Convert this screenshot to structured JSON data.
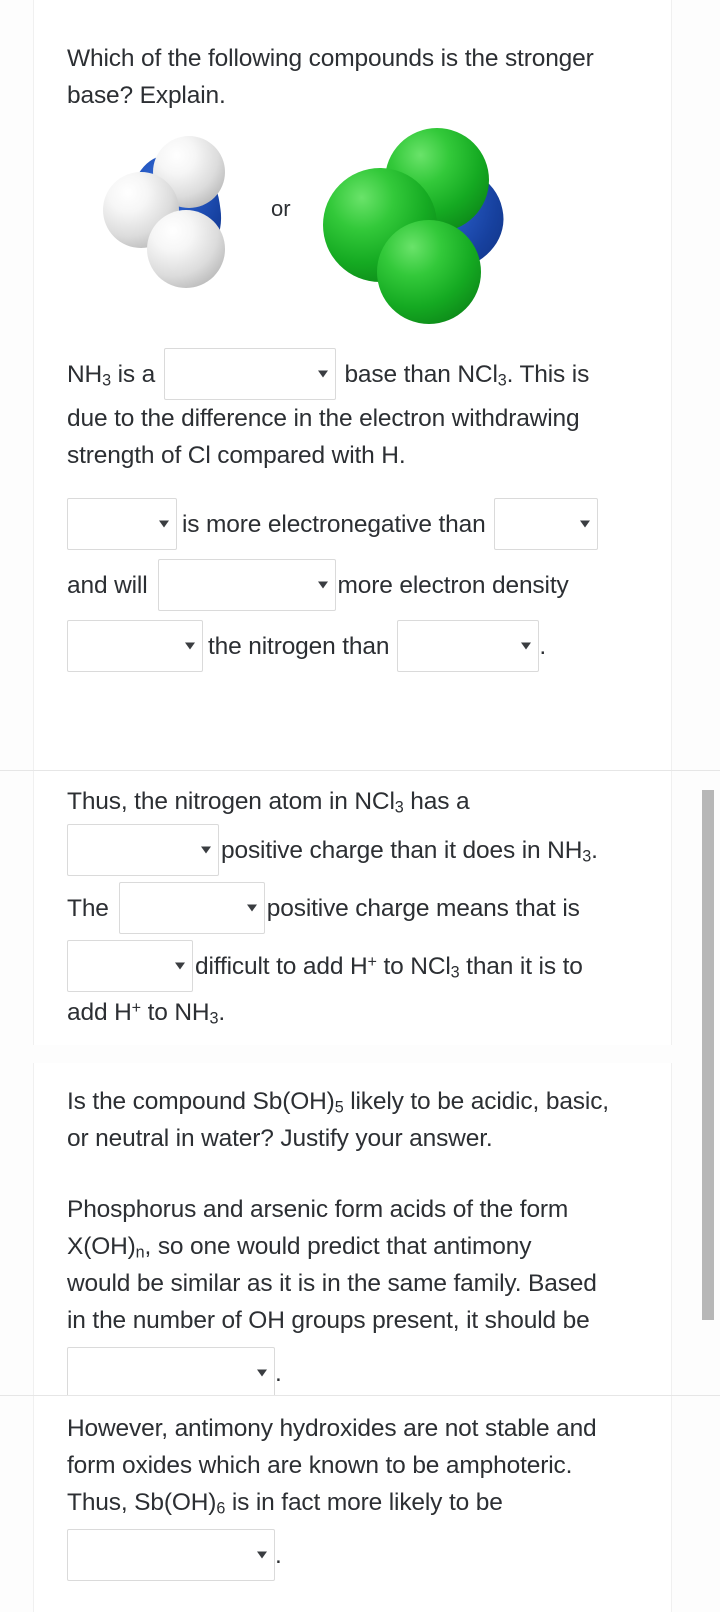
{
  "meta": {
    "accent_blue": "#1f4fb5",
    "chlorine_green": "#18a92a",
    "hydrogen_white": "#e8e8e8",
    "text_color": "#2c2f33",
    "border_color": "#dadada"
  },
  "card1": {
    "question": {
      "line1": "Which of the following compounds is the stronger",
      "line2": "base? Explain."
    },
    "molecules": {
      "left": {
        "name": "ammonia-model",
        "formula": "NH3",
        "center_atom": "N",
        "outer_atoms": [
          "H",
          "H",
          "H"
        ]
      },
      "separator": "or",
      "right": {
        "name": "nitrogen-trichloride-model",
        "formula": "NCl3",
        "center_atom": "N",
        "outer_atoms": [
          "Cl",
          "Cl",
          "Cl"
        ]
      }
    },
    "statement1": {
      "pre": "NH",
      "sub1": "3",
      "mid": " is a ",
      "dropdown1_value": "",
      "post": " base than NCl",
      "sub2": "3",
      "tail": ". This is"
    },
    "statement1_line2": "due to the difference in the electron withdrawing",
    "statement1_line3": "strength of Cl compared with H.",
    "statement2": {
      "dropdown2_value": "",
      "text1": "is more electronegative than",
      "dropdown3_value": ""
    },
    "statement3": {
      "text1": "and will",
      "dropdown4_value": "",
      "text2": "more electron density"
    },
    "statement4": {
      "dropdown5_value": "",
      "text1": "the nitrogen than",
      "dropdown6_value": "",
      "text2": "."
    }
  },
  "card2": {
    "line1": {
      "pre": "Thus, the nitrogen atom in NCl",
      "sub": "3",
      "post": " has a"
    },
    "line2": {
      "dropdown1_value": "",
      "text": "positive charge than it does in NH",
      "sub": "3",
      "post": "."
    },
    "line3": {
      "pre": "The",
      "dropdown2_value": "",
      "text": "positive charge means that is"
    },
    "line4": {
      "dropdown3_value": "",
      "pre": "difficult to add H",
      "sup1": "+",
      "mid": " to NCl",
      "sub1": "3",
      "post": " than it is to"
    },
    "line5": {
      "pre": "add H",
      "sup": "+",
      "mid": " to NH",
      "sub": "3",
      "post": "."
    }
  },
  "card3": {
    "question": {
      "pre": "Is the compound Sb(OH)",
      "sub": "5",
      "post": " likely to be acidic, basic,",
      "line2": "or neutral in water? Justify your answer."
    },
    "paragraph": {
      "line1": "Phosphorus and arsenic form acids of the form",
      "line2_pre": "X(OH)",
      "line2_sub": "n",
      "line2_post": ", so one would predict that antimony",
      "line3": "would be similar as it is in the same family. Based",
      "line4": "in the number of OH groups present, it should be"
    },
    "dropdown1_value": "",
    "dropdown1_suffix": "."
  },
  "card4": {
    "paragraph": {
      "line1": "However, antimony hydroxides are not stable and",
      "line2": "form oxides which are known to be amphoteric.",
      "line3_pre": "Thus, Sb(OH)",
      "line3_sub": "6",
      "line3_post": " is in fact more likely to be"
    },
    "dropdown1_value": "",
    "dropdown1_suffix": "."
  },
  "scrollbar": {
    "name": "vertical-scrollbar",
    "thumb_color": "#b7b7b7"
  }
}
